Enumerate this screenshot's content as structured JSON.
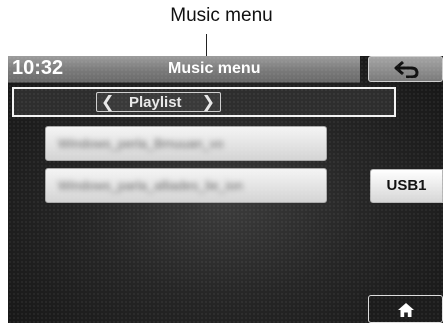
{
  "annotation": {
    "label": "Music menu"
  },
  "header": {
    "time": "10:32",
    "title": "Music menu"
  },
  "selector": {
    "label": "Playlist",
    "prev_icon": "chevron-left-icon",
    "next_icon": "chevron-right-icon"
  },
  "tracks": [
    {
      "name": "Windows_perla_Bmuuan_vo",
      "obscured": true
    },
    {
      "name": "Windows_parla_alliades_lie_ion",
      "obscured": true
    }
  ],
  "source": {
    "label": "USB1"
  },
  "icons": {
    "back": "back-arrow-icon",
    "home": "home-icon"
  },
  "colors": {
    "title_bar": "#8a8a8a",
    "screen_bg": "#262626",
    "button_face": "#e6e6e6",
    "highlight_outline": "#f2f2f2"
  }
}
